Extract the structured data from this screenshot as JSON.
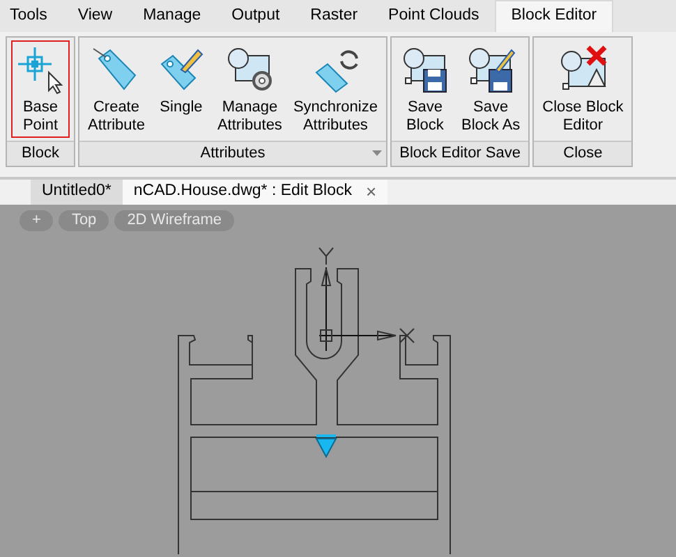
{
  "menu_tabs": [
    {
      "label": "Tools",
      "selected": false
    },
    {
      "label": "View",
      "selected": false
    },
    {
      "label": "Manage",
      "selected": false
    },
    {
      "label": "Output",
      "selected": false
    },
    {
      "label": "Raster",
      "selected": false
    },
    {
      "label": "Point Clouds",
      "selected": false
    },
    {
      "label": "Block Editor",
      "selected": true
    }
  ],
  "ribbon_panels": [
    {
      "title": "Block",
      "has_menu": false,
      "buttons": [
        {
          "label": "Base\nPoint",
          "kind": "basepoint",
          "highlighted": true
        }
      ]
    },
    {
      "title": "Attributes",
      "has_menu": true,
      "buttons": [
        {
          "label": "Create\nAttribute",
          "kind": "tag",
          "highlighted": false
        },
        {
          "label": "Single",
          "kind": "tagpen",
          "highlighted": false
        },
        {
          "label": "Manage\nAttributes",
          "kind": "manage",
          "highlighted": false
        },
        {
          "label": "Synchronize\nAttributes",
          "kind": "sync",
          "highlighted": false
        }
      ]
    },
    {
      "title": "Block Editor Save",
      "has_menu": false,
      "buttons": [
        {
          "label": "Save\nBlock",
          "kind": "save",
          "highlighted": false
        },
        {
          "label": "Save\nBlock As",
          "kind": "saveas",
          "highlighted": false
        }
      ]
    },
    {
      "title": "Close",
      "has_menu": false,
      "buttons": [
        {
          "label": "Close Block\nEditor",
          "kind": "close",
          "highlighted": false
        }
      ]
    }
  ],
  "document_tabs": [
    {
      "label": "Untitled0*",
      "selected": false,
      "closable": false
    },
    {
      "label": "nCAD.House.dwg* : Edit Block",
      "selected": true,
      "closable": true,
      "close": "×"
    }
  ],
  "viewport_controls": [
    "+",
    "Top",
    "2D Wireframe"
  ]
}
